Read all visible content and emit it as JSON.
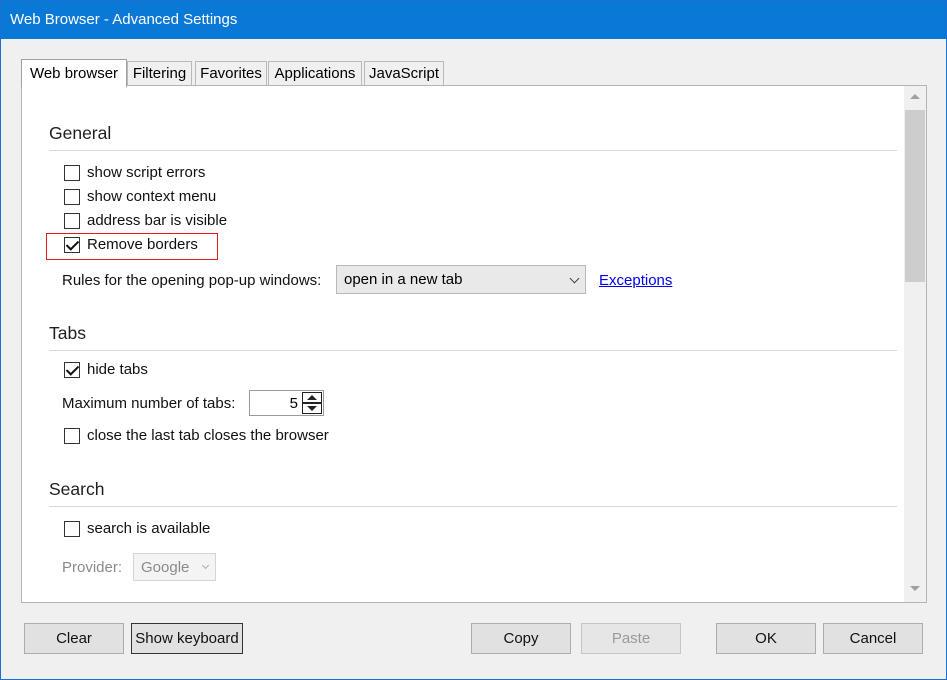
{
  "window": {
    "title": "Web Browser - Advanced Settings"
  },
  "tabs": [
    {
      "label": "Web browser",
      "active": true
    },
    {
      "label": "Filtering"
    },
    {
      "label": "Favorites"
    },
    {
      "label": "Applications"
    },
    {
      "label": "JavaScript"
    }
  ],
  "general": {
    "title": "General",
    "options": [
      {
        "label": "show script errors",
        "checked": false
      },
      {
        "label": "show context menu",
        "checked": false
      },
      {
        "label": "address bar is visible",
        "checked": false
      },
      {
        "label": "Remove borders",
        "checked": true
      }
    ],
    "popup_label": "Rules for the opening pop-up windows:",
    "popup_value": "open in a new tab",
    "exceptions_link": "Exceptions"
  },
  "tabs_section": {
    "title": "Tabs",
    "hide_tabs": {
      "label": "hide tabs",
      "checked": true
    },
    "max_tabs_label": "Maximum number of tabs:",
    "max_tabs_value": "5",
    "close_last": {
      "label": "close the last tab closes the browser",
      "checked": false
    }
  },
  "search": {
    "title": "Search",
    "available": {
      "label": "search is available",
      "checked": false
    },
    "provider_label": "Provider:",
    "provider_value": "Google"
  },
  "buttons": {
    "clear": "Clear",
    "show_keyboard": "Show keyboard",
    "copy": "Copy",
    "paste": "Paste",
    "ok": "OK",
    "cancel": "Cancel"
  },
  "colors": {
    "titlebar": "#0a78d7",
    "highlight": "#e02020",
    "link": "#0000ee"
  }
}
